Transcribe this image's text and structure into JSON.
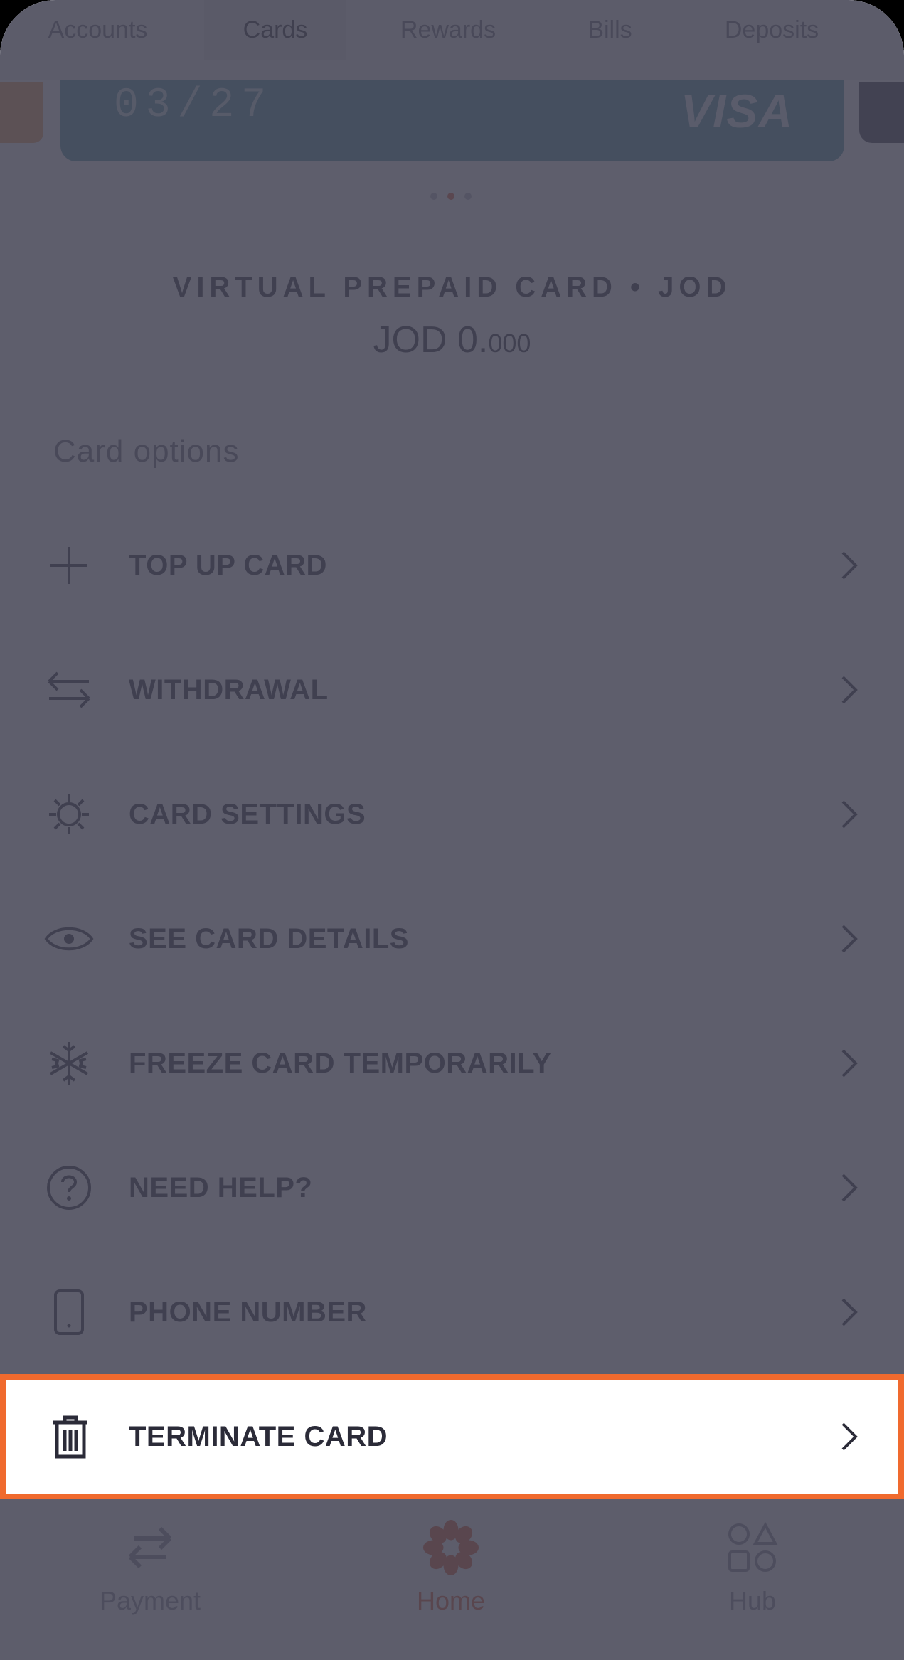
{
  "tabs": [
    {
      "label": "Accounts"
    },
    {
      "label": "Cards",
      "active": true
    },
    {
      "label": "Rewards"
    },
    {
      "label": "Bills"
    },
    {
      "label": "Deposits"
    }
  ],
  "card": {
    "expiry": "03/27",
    "brand": "VISA",
    "color": "#4d92a0",
    "pager": {
      "count": 3,
      "active_index": 1
    }
  },
  "card_type": "VIRTUAL PREPAID CARD  •  JOD",
  "balance": {
    "currency": "JOD",
    "whole": "JOD 0.",
    "decimals": "000"
  },
  "card_options": {
    "title": "Card options",
    "items": [
      {
        "label": "TOP UP CARD",
        "icon": "plus-icon"
      },
      {
        "label": "WITHDRAWAL",
        "icon": "swap-arrows-icon"
      },
      {
        "label": "CARD SETTINGS",
        "icon": "gear-icon"
      },
      {
        "label": "SEE CARD DETAILS",
        "icon": "eye-icon"
      },
      {
        "label": "FREEZE CARD TEMPORARILY",
        "icon": "snowflake-icon"
      },
      {
        "label": "NEED HELP?",
        "icon": "question-circle-icon"
      },
      {
        "label": "PHONE NUMBER",
        "icon": "phone-icon"
      },
      {
        "label": "TERMINATE CARD",
        "icon": "trash-icon",
        "highlighted": true
      }
    ]
  },
  "bottom_nav": [
    {
      "label": "Payment",
      "icon": "transfer-arrows-icon"
    },
    {
      "label": "Home",
      "icon": "flower-logo-icon",
      "active": true
    },
    {
      "label": "Hub",
      "icon": "shapes-icon"
    }
  ],
  "colors": {
    "accent": "#e0603a",
    "highlight_border": "#f06a2e",
    "overlay": "#444454"
  }
}
